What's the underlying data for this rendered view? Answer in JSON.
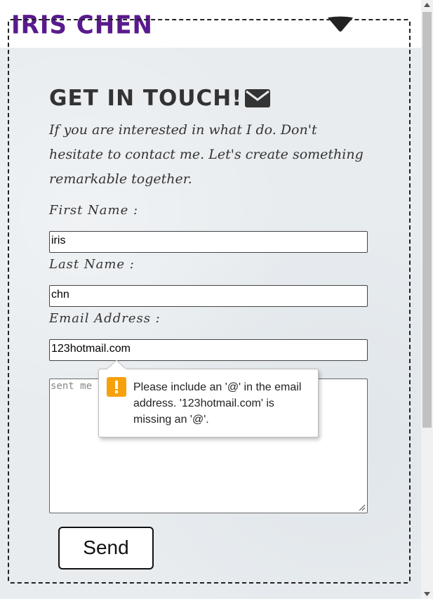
{
  "header": {
    "logo": "IRIS CHEN",
    "menu_icon": "caret-down-icon"
  },
  "contact": {
    "heading": "GET IN TOUCH!",
    "heading_icon": "envelope-icon",
    "intro": "If you are interested in what I do. Don't hesitate to contact me. Let's create something remarkable together.",
    "first_name_label": "First Name :",
    "first_name_value": "iris",
    "last_name_label": "Last Name :",
    "last_name_value": "chn",
    "email_label": "Email Address :",
    "email_value": "123hotmail.com",
    "message_placeholder": "sent me",
    "send_label": "Send"
  },
  "validation_tooltip": {
    "icon": "warning-icon",
    "message": "Please include an '@' in the email address. '123hotmail.com' is missing an '@'."
  },
  "colors": {
    "brand": "#5a1a8e",
    "warning": "#f6a10b"
  }
}
